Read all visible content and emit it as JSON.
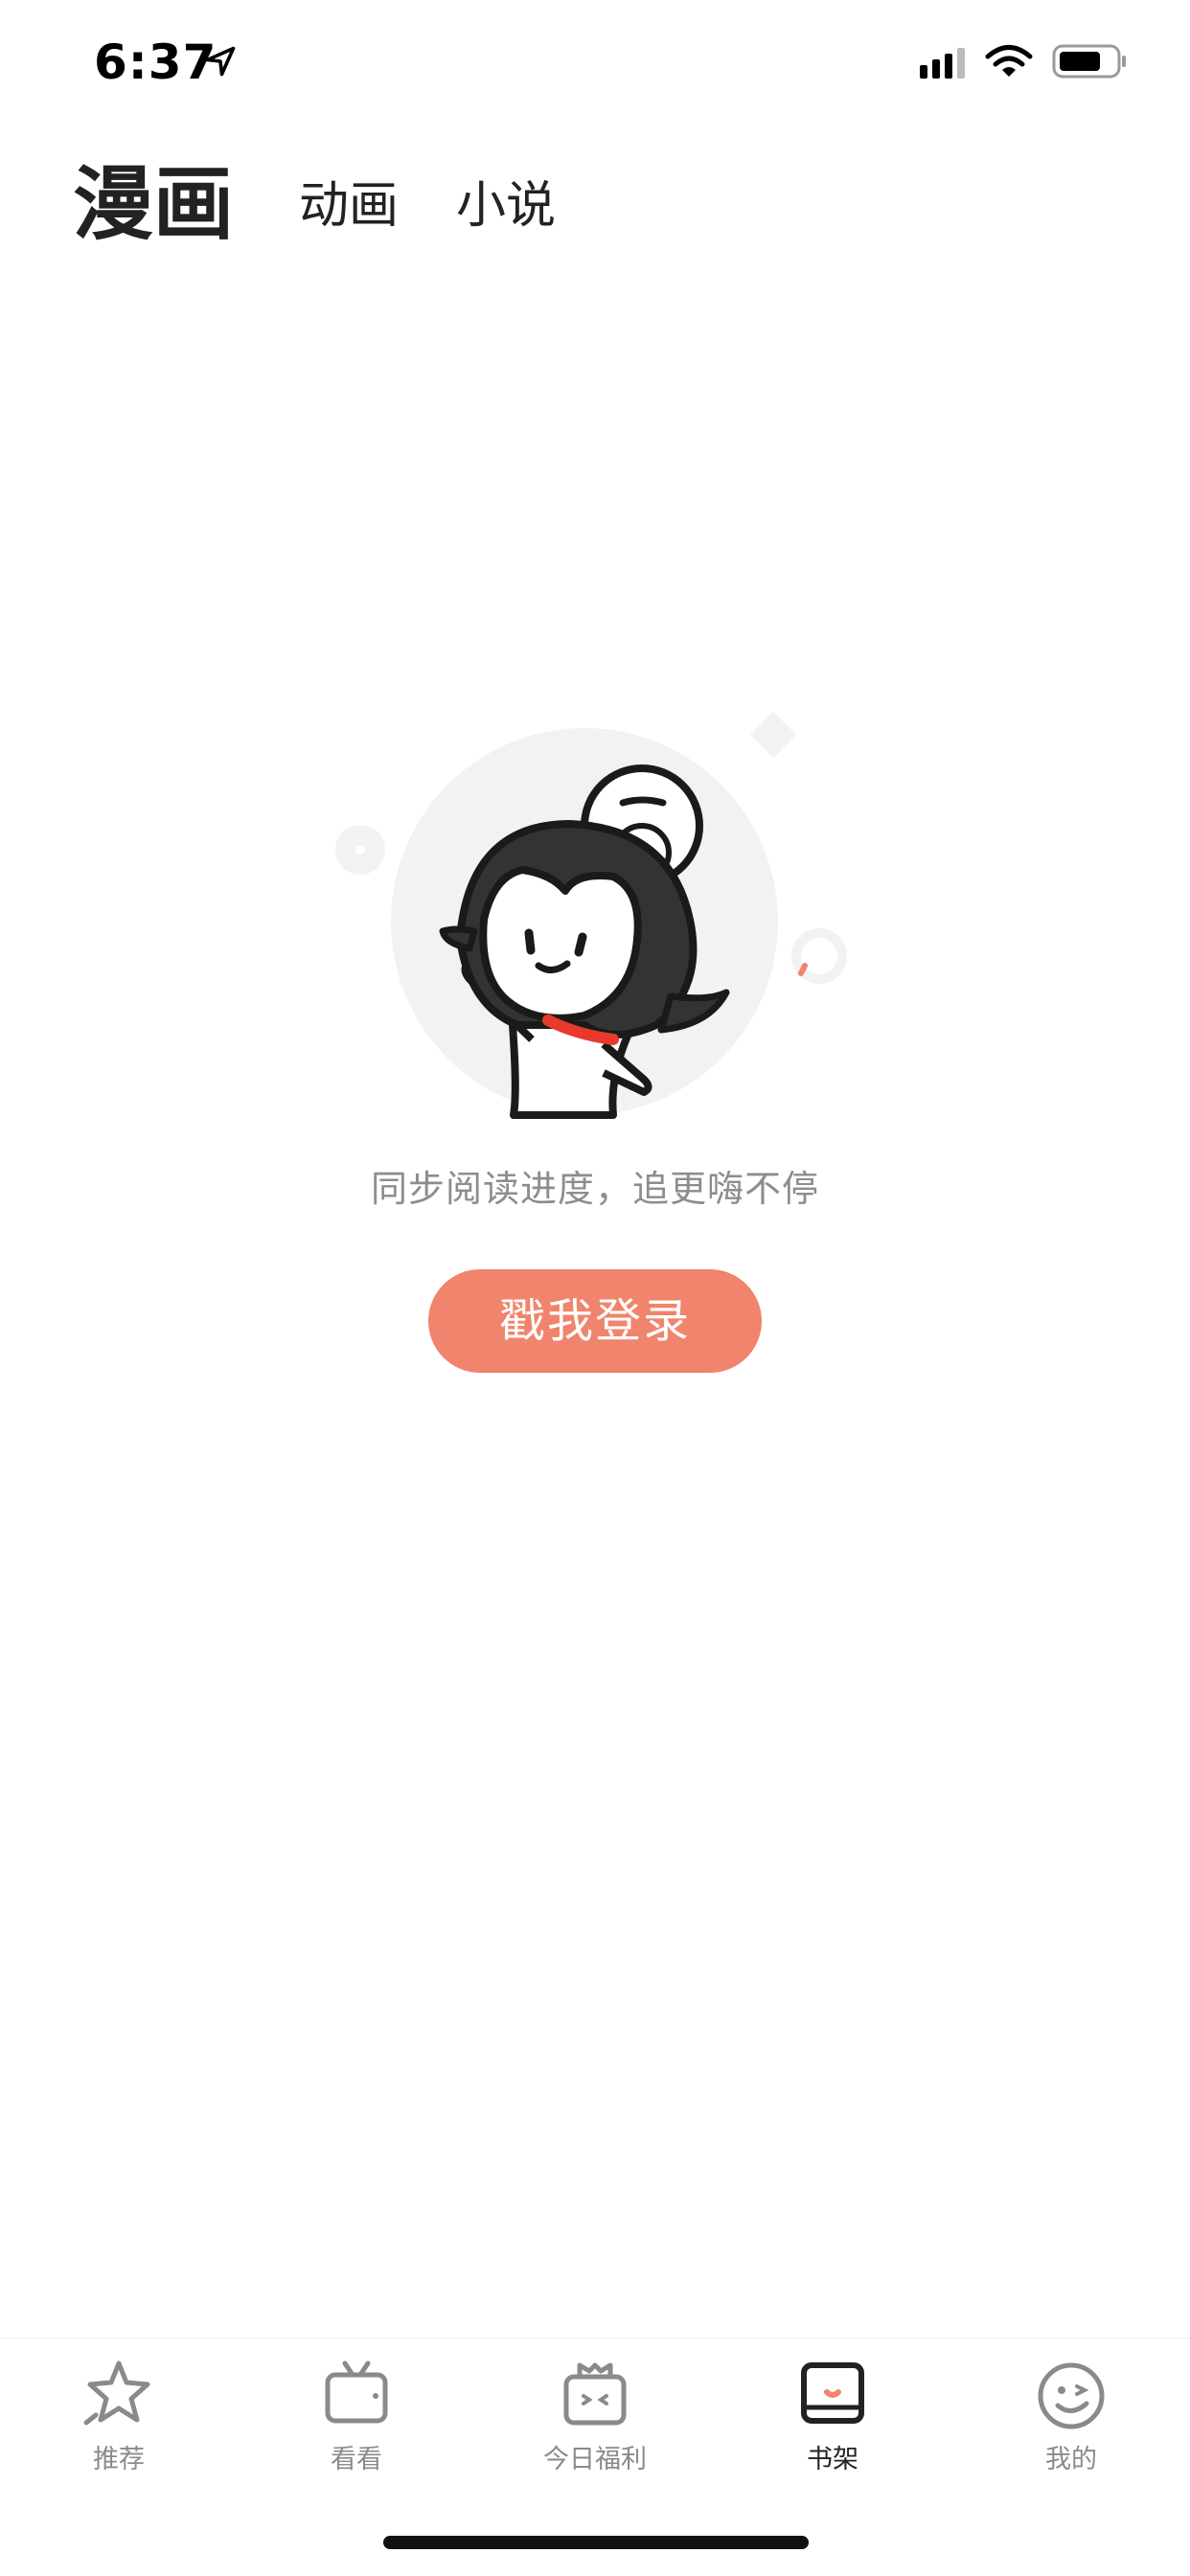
{
  "status_bar": {
    "time": "6:37"
  },
  "top_tabs": {
    "manhua": "漫画",
    "donghua": "动画",
    "xiaoshuo": "小说"
  },
  "empty_state": {
    "message": "同步阅读进度，追更嗨不停",
    "login_button": "戳我登录"
  },
  "bottom_nav": {
    "items": [
      {
        "label": "推荐",
        "icon": "star-icon",
        "active": false
      },
      {
        "label": "看看",
        "icon": "tv-icon",
        "active": false
      },
      {
        "label": "今日福利",
        "icon": "gift-box-icon",
        "active": false
      },
      {
        "label": "书架",
        "icon": "bookshelf-icon",
        "active": true
      },
      {
        "label": "我的",
        "icon": "smiley-face-icon",
        "active": false
      }
    ]
  },
  "colors": {
    "accent": "#f0846c",
    "text_primary": "#222222",
    "text_secondary": "#8d8d8d",
    "illustration_bg": "#f2f2f2"
  }
}
